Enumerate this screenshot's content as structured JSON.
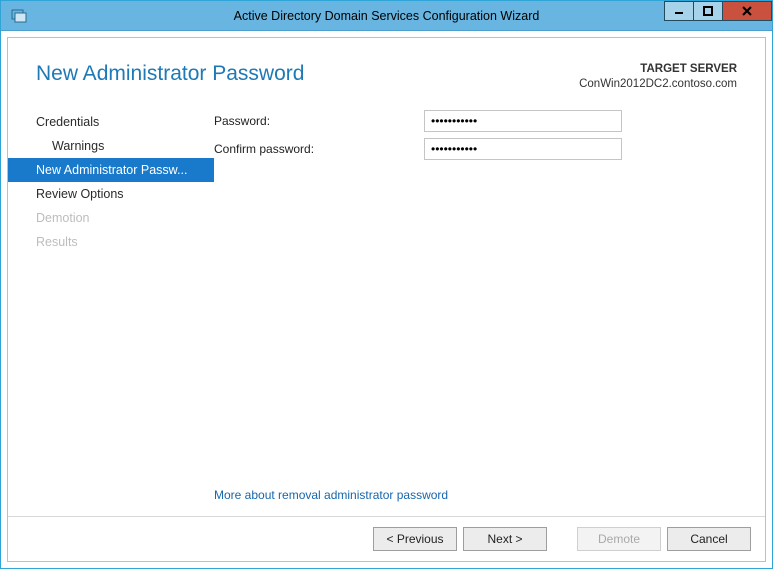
{
  "window": {
    "title": "Active Directory Domain Services Configuration Wizard"
  },
  "header": {
    "heading": "New Administrator Password",
    "target_label": "TARGET SERVER",
    "target_server": "ConWin2012DC2.contoso.com"
  },
  "sidebar": {
    "steps": [
      {
        "label": "Credentials",
        "state": "normal"
      },
      {
        "label": "Warnings",
        "state": "sub"
      },
      {
        "label": "New Administrator Passw...",
        "state": "selected"
      },
      {
        "label": "Review Options",
        "state": "normal"
      },
      {
        "label": "Demotion",
        "state": "disabled"
      },
      {
        "label": "Results",
        "state": "disabled"
      }
    ]
  },
  "form": {
    "password_label": "Password:",
    "confirm_label": "Confirm password:",
    "password_value": "•••••••••••",
    "confirm_value": "•••••••••••"
  },
  "help_link": "More about removal administrator password",
  "footer": {
    "previous": "< Previous",
    "next": "Next >",
    "demote": "Demote",
    "cancel": "Cancel"
  }
}
